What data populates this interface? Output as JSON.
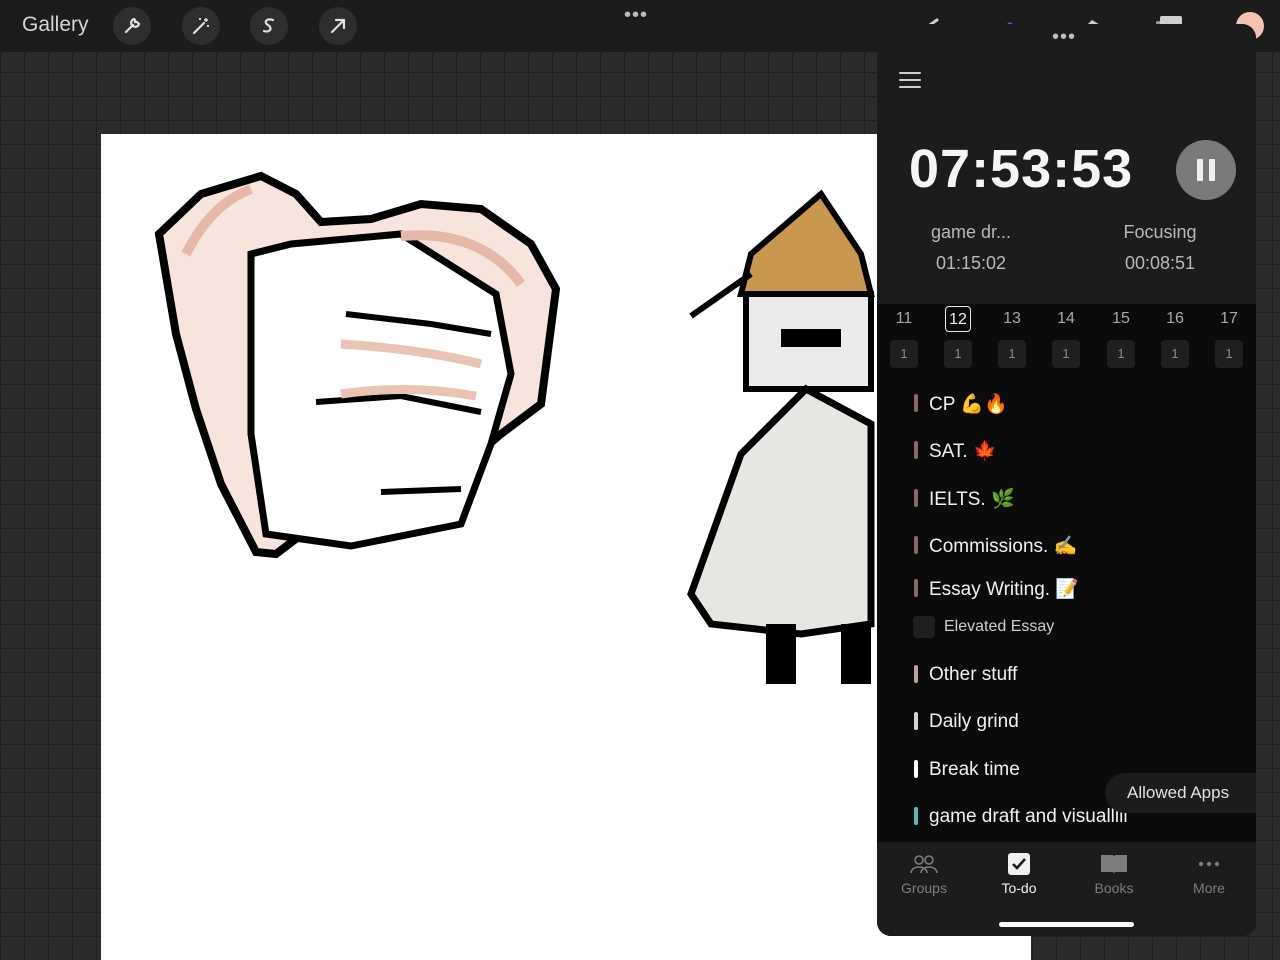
{
  "toolbar": {
    "gallery_label": "Gallery",
    "tools": [
      "wrench-icon",
      "magic-wand-icon",
      "selection-s-icon",
      "arrow-transform-icon"
    ],
    "right_tools": [
      "brush-icon",
      "smudge-icon",
      "eraser-icon",
      "layers-icon"
    ],
    "color_swatch": "#f2c3b3",
    "dots": "•••"
  },
  "panel": {
    "grab_dots": "•••",
    "timer": "07:53:53",
    "stats": [
      {
        "label": "game dr...",
        "value": "01:15:02"
      },
      {
        "label": "Focusing",
        "value": "00:08:51"
      }
    ],
    "dates": [
      {
        "day": "11",
        "count": "1"
      },
      {
        "day": "12",
        "count": "1",
        "selected": true
      },
      {
        "day": "13",
        "count": "1"
      },
      {
        "day": "14",
        "count": "1"
      },
      {
        "day": "15",
        "count": "1"
      },
      {
        "day": "16",
        "count": "1"
      },
      {
        "day": "17",
        "count": "1"
      }
    ],
    "todos": [
      {
        "label": "CP 💪🔥",
        "color": "#8a6a62"
      },
      {
        "label": "SAT. 🍁",
        "color": "#8a6a62"
      },
      {
        "label": "IELTS. 🌿",
        "color": "#8a6a62"
      },
      {
        "label": "Commissions. ✍️",
        "color": "#8a6a62"
      },
      {
        "label": "Essay Writing. 📝",
        "color": "#8a6a62"
      },
      {
        "label": "Other stuff",
        "color": "#bba39c"
      },
      {
        "label": "Daily grind",
        "color": "#d6d2d0"
      },
      {
        "label": "Break time",
        "color": "#ffffff"
      },
      {
        "label": "game draft and visualllll",
        "color": "#5fb8b0"
      }
    ],
    "subtask": {
      "label": "Elevated Essay"
    },
    "allowed_apps": "Allowed Apps",
    "tabs": [
      {
        "label": "Groups",
        "icon": "groups-icon"
      },
      {
        "label": "To-do",
        "icon": "todo-check-icon",
        "active": true
      },
      {
        "label": "Books",
        "icon": "book-icon"
      },
      {
        "label": "More",
        "icon": "more-dots-icon"
      }
    ]
  }
}
